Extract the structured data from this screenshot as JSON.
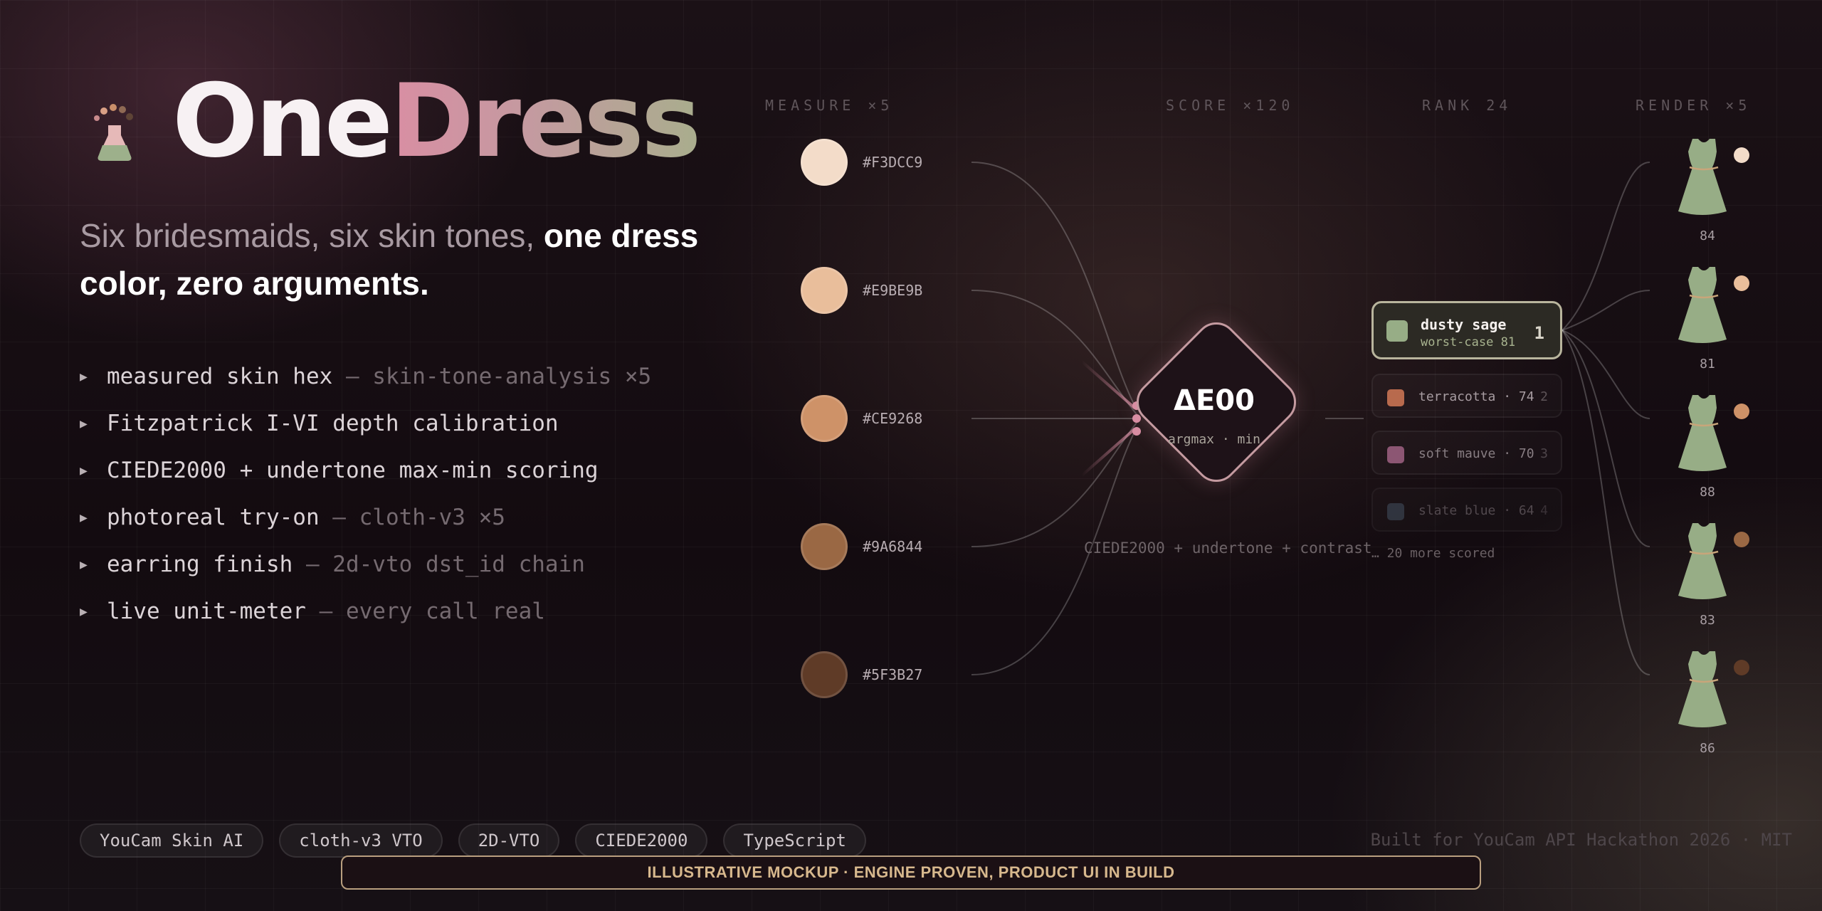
{
  "brand": {
    "name_part1": "One",
    "name_part2": "Dress",
    "logo_icon": "flask-with-dots-icon",
    "colors": {
      "rose": "#d98ea3",
      "sage": "#a9ad8d"
    }
  },
  "tagline": {
    "plain": "Six bridesmaids, six skin tones,",
    "bold": "one dress color, zero arguments."
  },
  "features": [
    {
      "text": "measured skin hex",
      "detail": "— skin-tone-analysis ×5"
    },
    {
      "text": "Fitzpatrick I-VI depth calibration",
      "detail": ""
    },
    {
      "text": "CIEDE2000 + undertone max-min scoring",
      "detail": ""
    },
    {
      "text": "photoreal try-on",
      "detail": "— cloth-v3 ×5"
    },
    {
      "text": "earring finish",
      "detail": "— 2d-vto dst_id chain"
    },
    {
      "text": "live unit-meter",
      "detail": "— every call real"
    }
  ],
  "pipeline": {
    "columns": {
      "measure": "MEASURE ×5",
      "score": "SCORE ×120",
      "rank": "RANK 24",
      "render": "RENDER ×5"
    },
    "skin_tones": [
      {
        "hex": "#F3DCC9"
      },
      {
        "hex": "#E9BE9B"
      },
      {
        "hex": "#CE9268"
      },
      {
        "hex": "#9A6844"
      },
      {
        "hex": "#5F3B27"
      }
    ],
    "engine": {
      "title": "ΔE00",
      "subtitle": "argmax · min",
      "caption": "CIEDE2000 + undertone + contrast"
    },
    "ranking": {
      "top": {
        "name": "dusty sage",
        "sub": "worst-case 81",
        "rank": "1",
        "color": "#97ad86"
      },
      "others": [
        {
          "label": "terracotta · 74",
          "rank": "2",
          "color": "#b86a4d"
        },
        {
          "label": "soft mauve · 70",
          "rank": "3",
          "color": "#8c5673"
        },
        {
          "label": "slate blue · 64",
          "rank": "4",
          "color": "#3c4552"
        }
      ],
      "more": "… 20 more scored"
    },
    "renders": [
      {
        "score": "84",
        "skin": "#F3DCC9"
      },
      {
        "score": "81",
        "skin": "#E9BE9B"
      },
      {
        "score": "88",
        "skin": "#CE9268"
      },
      {
        "score": "83",
        "skin": "#9A6844"
      },
      {
        "score": "86",
        "skin": "#5F3B27"
      }
    ]
  },
  "tech_tags": [
    "YouCam Skin AI",
    "cloth-v3 VTO",
    "2D-VTO",
    "CIEDE2000",
    "TypeScript"
  ],
  "credit": "Built for YouCam API Hackathon 2026 · MIT",
  "banner": "ILLUSTRATIVE MOCKUP  ·  ENGINE PROVEN, PRODUCT UI IN BUILD"
}
